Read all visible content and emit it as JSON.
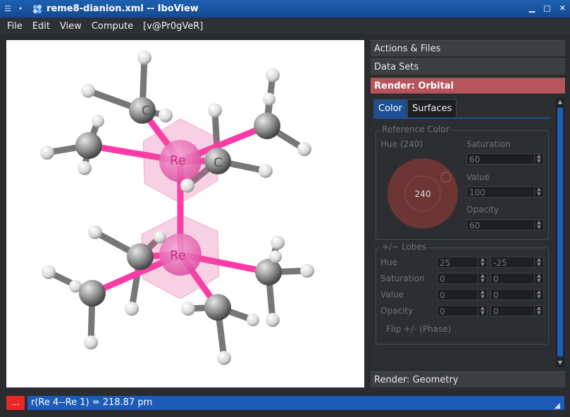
{
  "window": {
    "title": "reme8-dianion.xml -- IboView",
    "minimize": "▁",
    "maximize": "□",
    "close": "✕"
  },
  "menu": {
    "items": [
      "File",
      "Edit",
      "View",
      "Compute",
      "[v@Pr0gVeR]"
    ]
  },
  "molecule": {
    "atom_labels": [
      "Re",
      "Re",
      "C",
      "C"
    ]
  },
  "sidebar": {
    "sections": {
      "actions": "Actions & Files",
      "datasets": "Data Sets",
      "render_orbital": "Render: Orbital",
      "render_geometry": "Render: Geometry"
    },
    "tabs": [
      "Color",
      "Surfaces"
    ],
    "reference_color": {
      "title": "Reference Color",
      "hue_label": "Hue (240)",
      "hue_value": "240",
      "saturation_label": "Saturation",
      "saturation_value": "60",
      "value_label": "Value",
      "value_value": "100",
      "opacity_label": "Opacity",
      "opacity_value": "60"
    },
    "lobes": {
      "title": "+/− Lobes",
      "hue_label": "Hue",
      "hue_plus": "25",
      "hue_minus": "-25",
      "saturation_label": "Saturation",
      "saturation_plus": "0",
      "saturation_minus": "0",
      "value_label": "Value",
      "value_plus": "0",
      "value_minus": "0",
      "opacity_label": "Opacity",
      "opacity_plus": "0",
      "opacity_minus": "0",
      "flip_label": "Flip +/- (Phase)"
    }
  },
  "status": {
    "button": "...",
    "text": "r(Re 4--Re 1) = 218.87 pm"
  },
  "colors": {
    "titlebar": "#1e5fb0",
    "active_section": "#b5545a",
    "status_highlight": "#1c5bb8",
    "error_button": "#e82828",
    "rhenium": "#e44da8"
  }
}
